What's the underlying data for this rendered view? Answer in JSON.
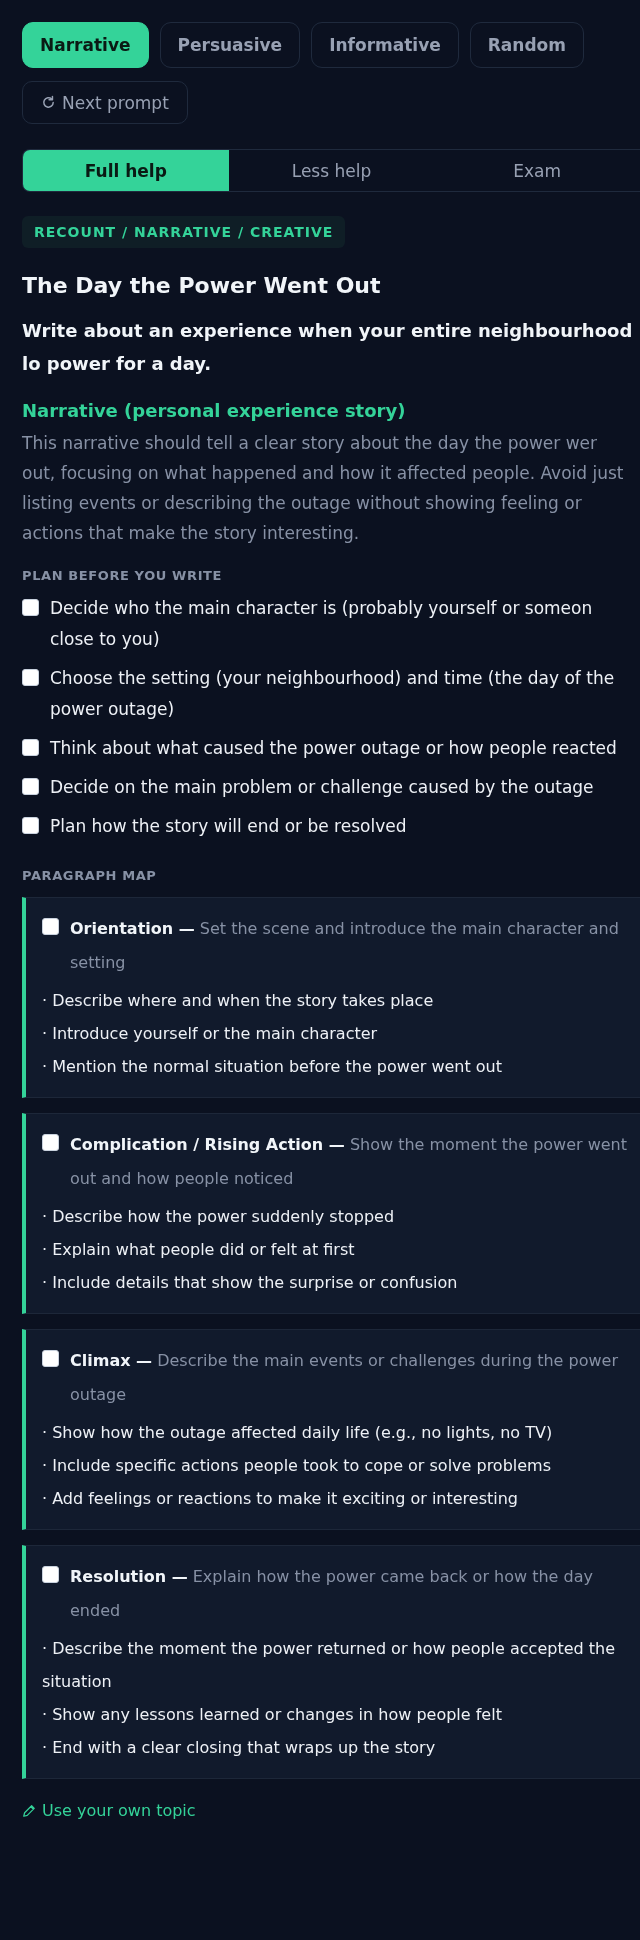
{
  "type_tabs": [
    {
      "label": "Narrative",
      "selected": true
    },
    {
      "label": "Persuasive",
      "selected": false
    },
    {
      "label": "Informative",
      "selected": false
    },
    {
      "label": "Random",
      "selected": false
    }
  ],
  "next_prompt_button": {
    "label": "Next prompt"
  },
  "help_modes": [
    {
      "label": "Full help",
      "selected": true
    },
    {
      "label": "Less help",
      "selected": false
    },
    {
      "label": "Exam",
      "selected": false
    }
  ],
  "prompt": {
    "tag": "RECOUNT / NARRATIVE / CREATIVE",
    "title": "The Day the Power Went Out",
    "question": "Write about an experience when your entire neighbourhood lo power for a day.",
    "genre_heading": "Narrative (personal experience story)",
    "genre_description": "This narrative should tell a clear story about the day the power wer out, focusing on what happened and how it affected people. Avoid just listing events or describing the outage without showing feeling or actions that make the story interesting."
  },
  "plan": {
    "heading": "PLAN BEFORE YOU WRITE",
    "items": [
      {
        "text": "Decide who the main character is (probably yourself or someon close to you)",
        "checked": false
      },
      {
        "text": "Choose the setting (your neighbourhood) and time (the day of the power outage)",
        "checked": false
      },
      {
        "text": "Think about what caused the power outage or how people reacted",
        "checked": false
      },
      {
        "text": "Decide on the main problem or challenge caused by the outage",
        "checked": false
      },
      {
        "text": "Plan how the story will end or be resolved",
        "checked": false
      }
    ]
  },
  "paragraph_map": {
    "heading": "PARAGRAPH MAP",
    "sections": [
      {
        "heading": "**Orientation —** Set the scene and introduce the main character and setting",
        "checked": false,
        "points": [
          "· Describe where and when the story takes place",
          "· Introduce yourself or the main character",
          "· Mention the normal situation before the power went out"
        ]
      },
      {
        "heading": "**Complication / Rising Action —** Show the moment the power went out and how people noticed",
        "checked": false,
        "points": [
          "· Describe how the power suddenly stopped",
          "· Explain what people did or felt at first",
          "· Include details that show the surprise or confusion"
        ]
      },
      {
        "heading": "**Climax —** Describe the main events or challenges during the power outage",
        "checked": false,
        "points": [
          "· Show how the outage affected daily life (e.g., no lights, no TV)",
          "· Include specific actions people took to cope or solve problems",
          "· Add feelings or reactions to make it exciting or interesting"
        ]
      },
      {
        "heading": "**Resolution —** Explain how the power came back or how the day ended",
        "checked": false,
        "points": [
          "· Describe the moment the power returned or how people accepted the situation",
          "· Show any lessons learned or changes in how people felt",
          "· End with a clear closing that wraps up the story"
        ]
      }
    ]
  },
  "own_topic_link": {
    "label": "Use your own topic"
  }
}
